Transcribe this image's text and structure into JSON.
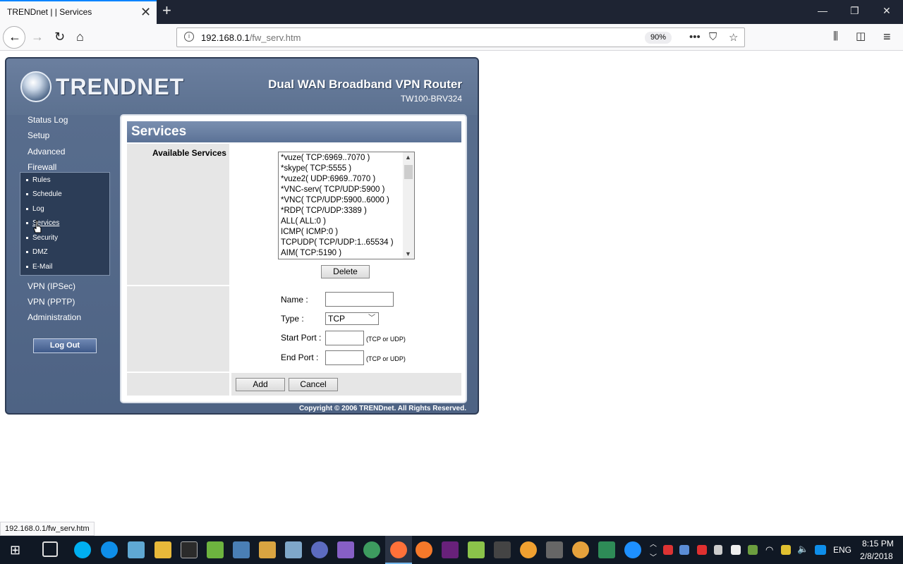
{
  "browser": {
    "tab_title": "TRENDnet | | Services",
    "url_host": "192.168.0.1",
    "url_path": "/fw_serv.htm",
    "zoom": "90%",
    "status_url": "192.168.0.1/fw_serv.htm"
  },
  "router": {
    "brand": "TRENDNET",
    "product_title": "Dual WAN Broadband VPN Router",
    "model": "TW100-BRV324",
    "menu": [
      "Status Log",
      "Setup",
      "Advanced",
      "Firewall"
    ],
    "submenu": [
      "Rules",
      "Schedule",
      "Log",
      "Services",
      "Security",
      "DMZ",
      "E-Mail"
    ],
    "menu_bottom": [
      "VPN (IPSec)",
      "VPN (PPTP)",
      "Administration"
    ],
    "logout_label": "Log Out",
    "copyright": "Copyright © 2006 TRENDnet. All Rights Reserved."
  },
  "services": {
    "title": "Services",
    "available_label": "Available Services",
    "list": [
      "*vuze( TCP:6969..7070 )",
      "*skype( TCP:5555 )",
      "*vuze2( UDP:6969..7070 )",
      "*VNC-serv( TCP/UDP:5900 )",
      "*VNC( TCP/UDP:5900..6000 )",
      "*RDP( TCP/UDP:3389 )",
      "ALL( ALL:0 )",
      "ICMP( ICMP:0 )",
      "TCPUDP( TCP/UDP:1..65534 )",
      "AIM( TCP:5190 )"
    ],
    "delete_label": "Delete",
    "name_label": "Name :",
    "type_label": "Type :",
    "type_value": "TCP",
    "start_port_label": "Start Port :",
    "end_port_label": "End Port :",
    "port_hint": "(TCP or UDP)",
    "add_label": "Add",
    "cancel_label": "Cancel"
  },
  "taskbar": {
    "lang": "ENG",
    "time": "8:15 PM",
    "date": "2/8/2018"
  }
}
